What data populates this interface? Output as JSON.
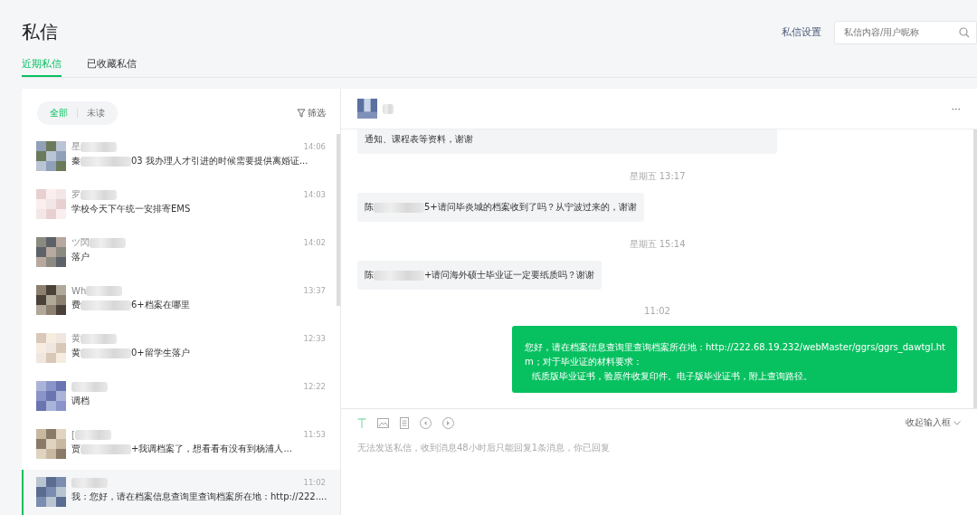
{
  "page": {
    "title": "私信",
    "settings_link": "私信设置",
    "search": {
      "placeholder": "私信内容/用户昵称"
    }
  },
  "tabs": [
    {
      "label": "近期私信",
      "selected": true
    },
    {
      "label": "已收藏私信",
      "selected": false
    }
  ],
  "list": {
    "filters": [
      {
        "label": "全部",
        "selected": true
      },
      {
        "label": "未读",
        "selected": false
      }
    ],
    "filter_button": "筛选",
    "items": [
      {
        "name": "星",
        "time": "14:06",
        "preview_before": "秦",
        "preview_after": "03 我办理人才引进的时候需要提供离婚证...",
        "selected": false
      },
      {
        "name": "罗",
        "time": "14:03",
        "preview_after": "学校今天下午统一安排寄EMS",
        "selected": false
      },
      {
        "name": "ツ閃",
        "time": "14:02",
        "preview_after": "落户",
        "selected": false
      },
      {
        "name": "Wh",
        "time": "13:37",
        "preview_before": "费",
        "preview_after": "6+档案在哪里",
        "selected": false
      },
      {
        "name": "黄",
        "time": "12:33",
        "preview_before": "黄",
        "preview_after": "0+留学生落户",
        "selected": false
      },
      {
        "time": "12:22",
        "preview_after": "调档",
        "selected": false
      },
      {
        "name": "[",
        "time": "11:53",
        "preview_before": "贾",
        "preview_after": "+我调档案了，想看看有没有到杨浦人...",
        "selected": false
      },
      {
        "time": "11:02",
        "preview_before": "我：",
        "preview_after": "您好，请在档案信息查询里查询档案所在地：http://222....",
        "selected": true
      }
    ]
  },
  "chat": {
    "more": "···",
    "messages": [
      {
        "kind": "incoming",
        "after": "通知、课程表等资料，谢谢"
      },
      {
        "kind": "time",
        "text": "星期五 13:17"
      },
      {
        "kind": "incoming",
        "before": "陈",
        "after": "5+请问毕炎城的档案收到了吗？从宁波过来的，谢谢"
      },
      {
        "kind": "time",
        "text": "星期五 15:14"
      },
      {
        "kind": "incoming",
        "before": "陈",
        "after": "+请问海外硕士毕业证一定要纸质吗？谢谢"
      },
      {
        "kind": "time",
        "text": "11:02"
      },
      {
        "kind": "outgoing",
        "lines": [
          "您好，请在档案信息查询里查询档案所在地：http://222.68.19.232/webMaster/ggrs/ggrs_dawtgl.htm；对于毕业证的材料要求：",
          "纸质版毕业证书，验原件收复印件。电子版毕业证书，附上查询路径。"
        ]
      }
    ],
    "collapse_button": "收起输入框",
    "notice": "无法发送私信，收到消息48小时后只能回复1条消息，你已回复"
  }
}
